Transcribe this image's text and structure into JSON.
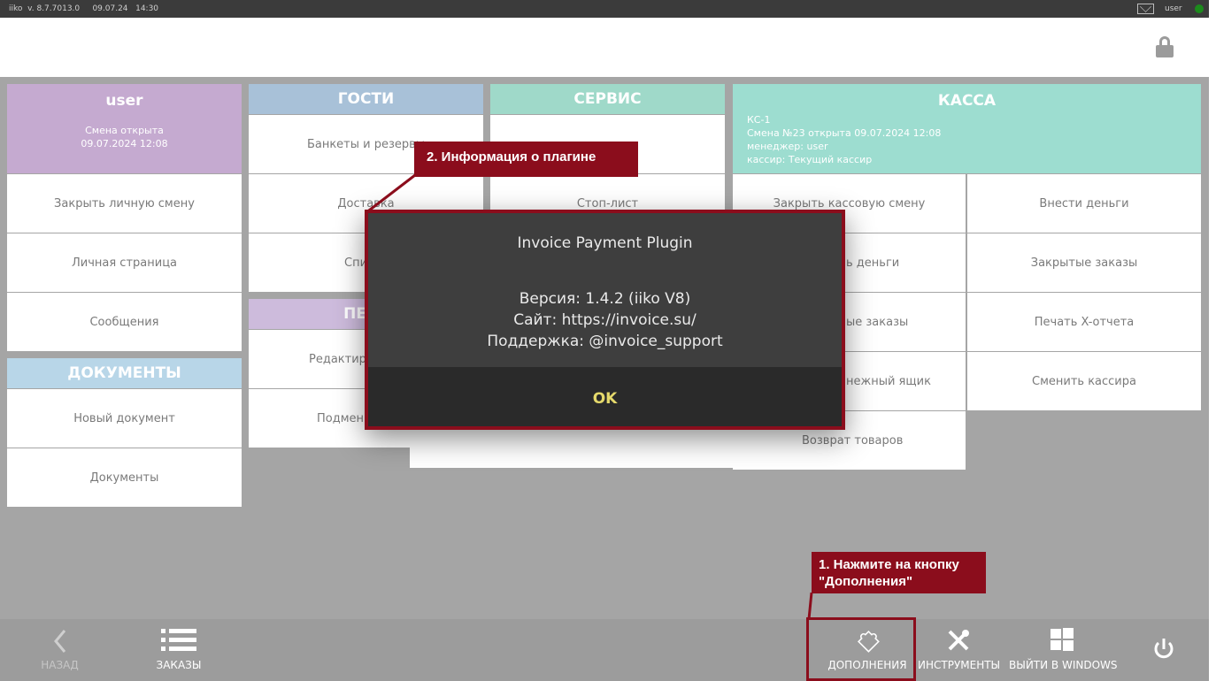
{
  "topbar": {
    "version": "iiko  v. 8.7.7013.0     09.07.24   14:30",
    "user": "user"
  },
  "user_panel": {
    "title": "user",
    "shift_status": "Смена открыта",
    "shift_date": "09.07.2024 12:08",
    "items": [
      "Закрыть личную смену",
      "Личная страница",
      "Сообщения"
    ]
  },
  "documents_panel": {
    "title": "ДОКУМЕНТЫ",
    "items": [
      "Новый документ",
      "Документы"
    ]
  },
  "guests_panel": {
    "title": "ГОСТИ",
    "items": [
      "Банкеты и резервы",
      "Доставка",
      "Список"
    ]
  },
  "personnel_panel": {
    "title": "ПЕРС",
    "items": [
      "Редактиро",
      "Подмен"
    ]
  },
  "service_panel": {
    "title": "СЕРВИС",
    "items": [
      "Стоп-лист"
    ]
  },
  "kassa_panel": {
    "title": "КАССА",
    "info": [
      "КС-1",
      "Смена №23 открыта 09.07.2024 12:08",
      "менеджер: user",
      "кассир: Текущий кассир"
    ],
    "left_items": [
      "Закрыть кассовую смену",
      "ь деньги",
      "ые заказы",
      "нежный ящик",
      "Возврат товаров"
    ],
    "right_items": [
      "Внести деньги",
      "Закрытые заказы",
      "Печать X-отчета",
      "Сменить кассира"
    ]
  },
  "dialog": {
    "title": "Invoice Payment Plugin",
    "version": "Версия: 1.4.2 (iiko V8)",
    "site": "Сайт: https://invoice.su/",
    "support": "Поддержка: @invoice_support",
    "ok_label": "OK"
  },
  "callouts": {
    "step2": "2. Информация о плагине",
    "step1_line1": "1. Нажмите на кнопку",
    "step1_line2": "\"Дополнения\""
  },
  "bottom_bar": {
    "back": "НАЗАД",
    "orders": "ЗАКАЗЫ",
    "addons": "ДОПОЛНЕНИЯ",
    "tools": "ИНСТРУМЕНТЫ",
    "exit_windows": "ВЫЙТИ В WINDOWS"
  },
  "colors": {
    "user_head": "#c5aad0",
    "documents_head": "#b8d6e8",
    "guests_head": "#a8c1d8",
    "personnel_head": "#cdbbdc",
    "service_head": "#9fd9c9",
    "kassa_head": "#9dddd0",
    "annotation": "#8b0d1c"
  }
}
